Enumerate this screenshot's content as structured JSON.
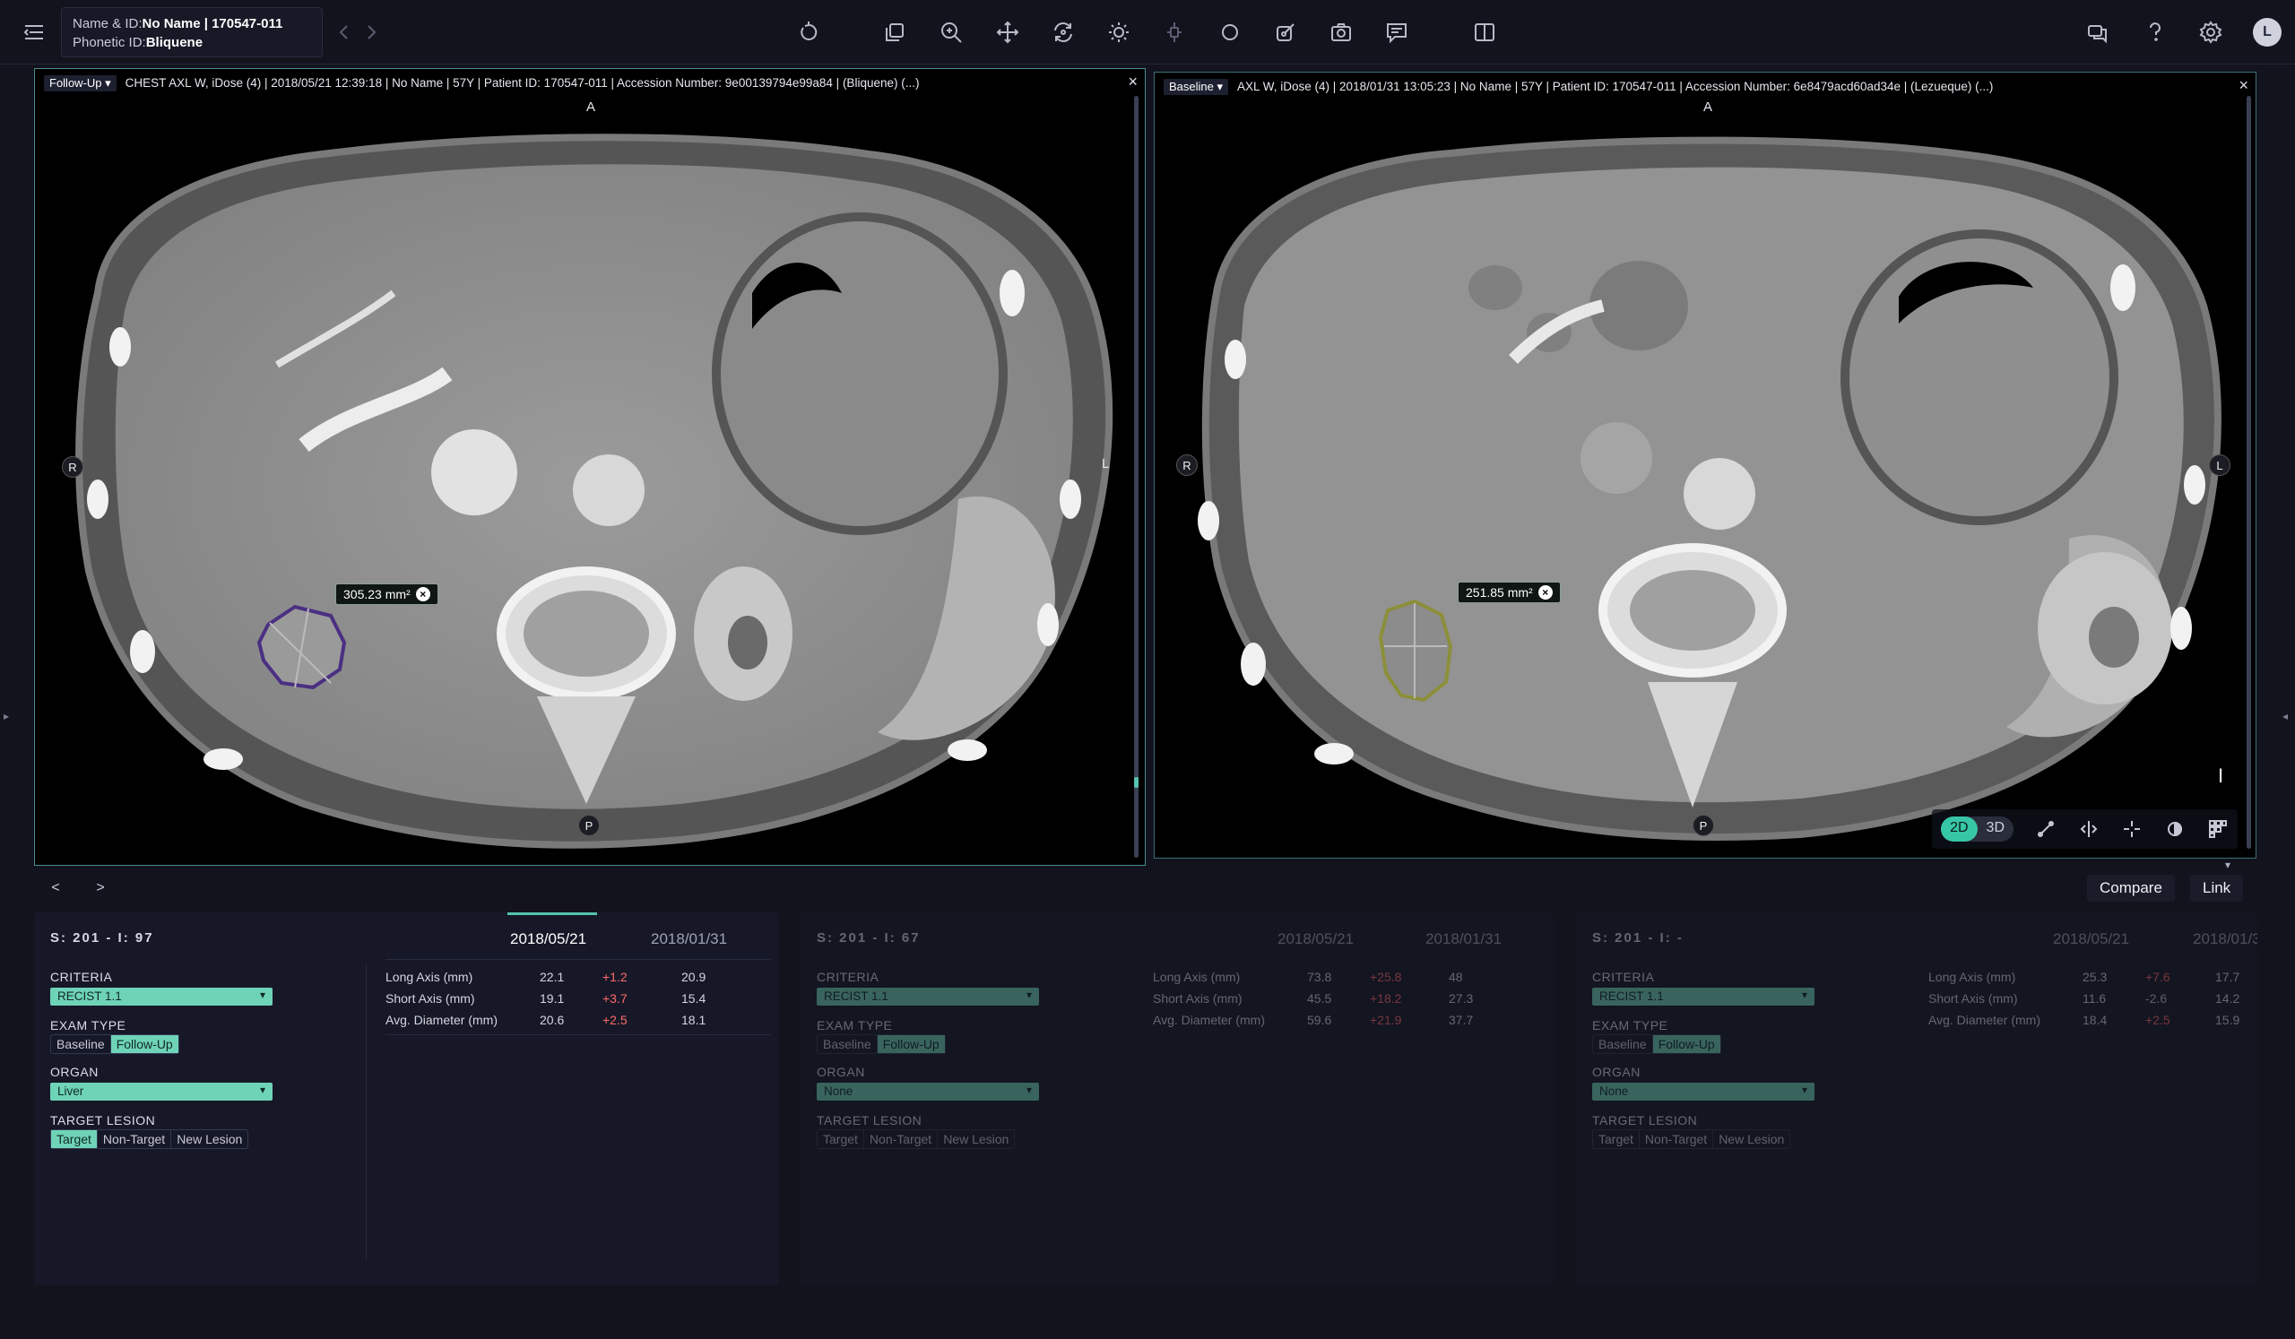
{
  "patient": {
    "name_label": "Name & ID:",
    "name_value": "No Name | 170547-011",
    "phonetic_label": "Phonetic ID:",
    "phonetic_value": "Bliquene"
  },
  "toolbar": {
    "icons": [
      "menu-icon",
      "back-icon",
      "forward-icon",
      "reset-icon",
      "series-icon",
      "zoom-icon",
      "pan-icon",
      "rotate-icon",
      "window-level-icon",
      "probe-icon",
      "ellipse-icon",
      "brush-icon",
      "capture-icon",
      "annotation-icon",
      "layout-icon",
      "chat-icon",
      "help-icon",
      "settings-icon"
    ],
    "avatar_initial": "L"
  },
  "viewports": [
    {
      "badge": "Follow-Up ▾",
      "header": "CHEST AXL W, iDose (4) | 2018/05/21 12:39:18 | No Name | 57Y | Patient ID: 170547-011 | Accession Number: 9e00139794e99a84 | (Bliquene) (...)",
      "measurement": "305.23 mm²",
      "lesion_color": "#4b2f82",
      "orientation": {
        "top": "A",
        "bottom": "P",
        "left": "R",
        "right": "L"
      }
    },
    {
      "badge": "Baseline ▾",
      "header": "AXL W, iDose (4) | 2018/01/31 13:05:23 | No Name | 57Y | Patient ID: 170547-011 | Accession Number: 6e8479acd60ad34e | (Lezueque) (...)",
      "measurement": "251.85 mm²",
      "lesion_color": "#8c8f3a",
      "orientation": {
        "top": "A",
        "bottom": "P",
        "left": "R",
        "right": "L"
      },
      "mode_2d": "2D",
      "mode_3d": "3D",
      "scroll_indicator": "I"
    }
  ],
  "nav": {
    "prev": "<",
    "next": ">",
    "compare": "Compare",
    "link": "Link"
  },
  "panels": [
    {
      "title": "S: 201 - I: 97",
      "criteria_label": "CRITERIA",
      "criteria_value": "RECIST 1.1",
      "exam_label": "EXAM TYPE",
      "exam_options": [
        "Baseline",
        "Follow-Up"
      ],
      "exam_selected": "Follow-Up",
      "organ_label": "ORGAN",
      "organ_value": "Liver",
      "lesion_label": "TARGET LESION",
      "lesion_options": [
        "Target",
        "Non-Target",
        "New Lesion"
      ],
      "lesion_selected": "Target",
      "dates": [
        "2018/05/21",
        "2018/01/31"
      ],
      "rows": [
        {
          "name": "Long Axis (mm)",
          "cur": "22.1",
          "delta": "+1.2",
          "base": "20.9"
        },
        {
          "name": "Short Axis (mm)",
          "cur": "19.1",
          "delta": "+3.7",
          "base": "15.4"
        },
        {
          "name": "Avg. Diameter (mm)",
          "cur": "20.6",
          "delta": "+2.5",
          "base": "18.1"
        }
      ]
    },
    {
      "title": "S: 201 - I: 67",
      "criteria_label": "CRITERIA",
      "criteria_value": "RECIST 1.1",
      "exam_label": "EXAM TYPE",
      "exam_options": [
        "Baseline",
        "Follow-Up"
      ],
      "exam_selected": "Follow-Up",
      "organ_label": "ORGAN",
      "organ_value": "None",
      "lesion_label": "TARGET LESION",
      "lesion_options": [
        "Target",
        "Non-Target",
        "New Lesion"
      ],
      "lesion_selected": "",
      "dates": [
        "2018/05/21",
        "2018/01/31"
      ],
      "rows": [
        {
          "name": "Long Axis (mm)",
          "cur": "73.8",
          "delta": "+25.8",
          "base": "48"
        },
        {
          "name": "Short Axis (mm)",
          "cur": "45.5",
          "delta": "+18.2",
          "base": "27.3"
        },
        {
          "name": "Avg. Diameter (mm)",
          "cur": "59.6",
          "delta": "+21.9",
          "base": "37.7"
        }
      ]
    },
    {
      "title": "S: 201 - I: -",
      "criteria_label": "CRITERIA",
      "criteria_value": "RECIST 1.1",
      "exam_label": "EXAM TYPE",
      "exam_options": [
        "Baseline",
        "Follow-Up"
      ],
      "exam_selected": "Follow-Up",
      "organ_label": "ORGAN",
      "organ_value": "None",
      "lesion_label": "TARGET LESION",
      "lesion_options": [
        "Target",
        "Non-Target",
        "New Lesion"
      ],
      "lesion_selected": "",
      "dates": [
        "2018/05/21",
        "2018/01/3"
      ],
      "rows": [
        {
          "name": "Long Axis (mm)",
          "cur": "25.3",
          "delta": "+7.6",
          "base": "17.7"
        },
        {
          "name": "Short Axis (mm)",
          "cur": "11.6",
          "delta": "-2.6",
          "base": "14.2"
        },
        {
          "name": "Avg. Diameter (mm)",
          "cur": "18.4",
          "delta": "+2.5",
          "base": "15.9"
        }
      ]
    }
  ]
}
